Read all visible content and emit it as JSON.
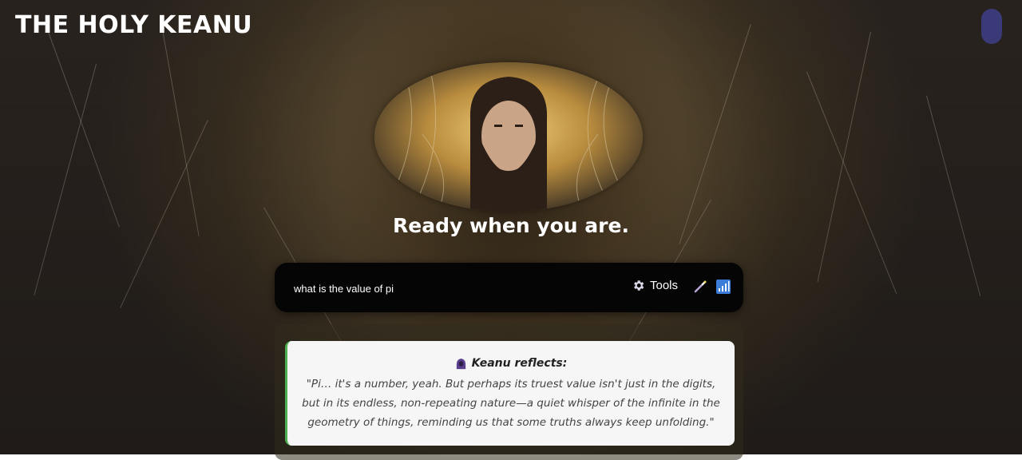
{
  "header": {
    "title": "THE HOLY KEANU"
  },
  "hero": {
    "headline": "Ready when you are."
  },
  "input_bar": {
    "value": "what is the value of pi",
    "tools_label": "Tools",
    "icons": [
      "gear-icon",
      "magic-wand-icon",
      "signal-bars-icon"
    ]
  },
  "response": {
    "heading": "Keanu reflects:",
    "icon": "hooded-figure-icon",
    "text": "\"Pi… it's a number, yeah. But perhaps its truest value isn't just in the digits, but in its endless, non-repeating nature—a quiet whisper of the infinite in the geometry of things, reminding us that some truths always keep unfolding.\"",
    "accent_color": "#4caf50"
  },
  "colors": {
    "toggle": "#3a3a78",
    "input_bg": "#050505",
    "card_bg": "#f6f6f6"
  }
}
